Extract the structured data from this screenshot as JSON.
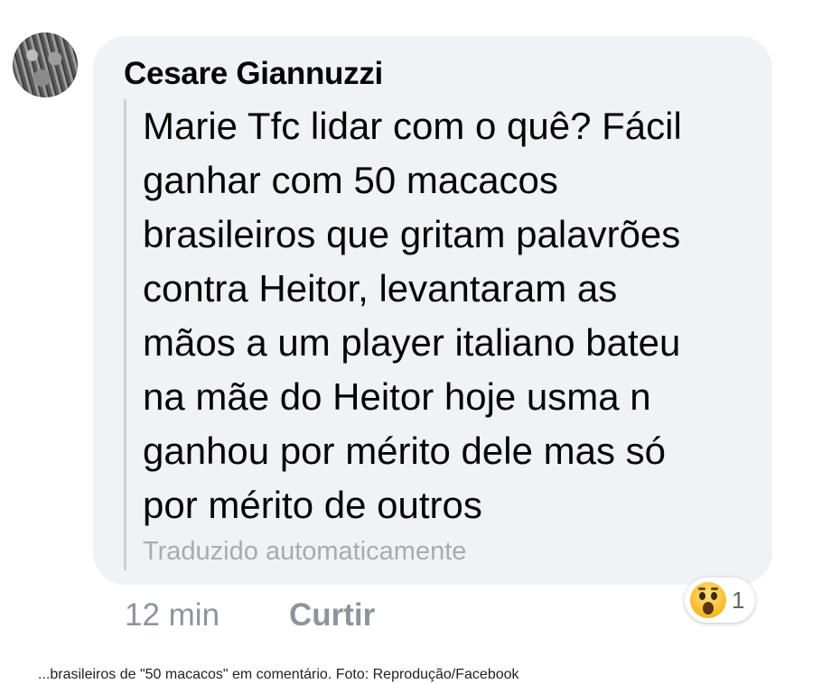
{
  "comment": {
    "author": "Cesare Giannuzzi",
    "lines": [
      "Marie Tfc lidar com o quê? Fácil",
      "ganhar com 50 macacos",
      "brasileiros que gritam palavrões",
      "contra Heitor, levantaram as",
      "mãos a um player italiano bateu",
      "na mãe do Heitor hoje usma n",
      "ganhou por mérito dele mas só",
      "por mérito de outros"
    ],
    "translation_note": "Traduzido automaticamente",
    "time": "12 min",
    "like_label": "Curtir",
    "reaction": {
      "icon": "wow-reaction-icon",
      "count": "1"
    }
  },
  "caption": "...brasileiros de \"50 macacos\" em comentário. Foto: Reprodução/Facebook"
}
